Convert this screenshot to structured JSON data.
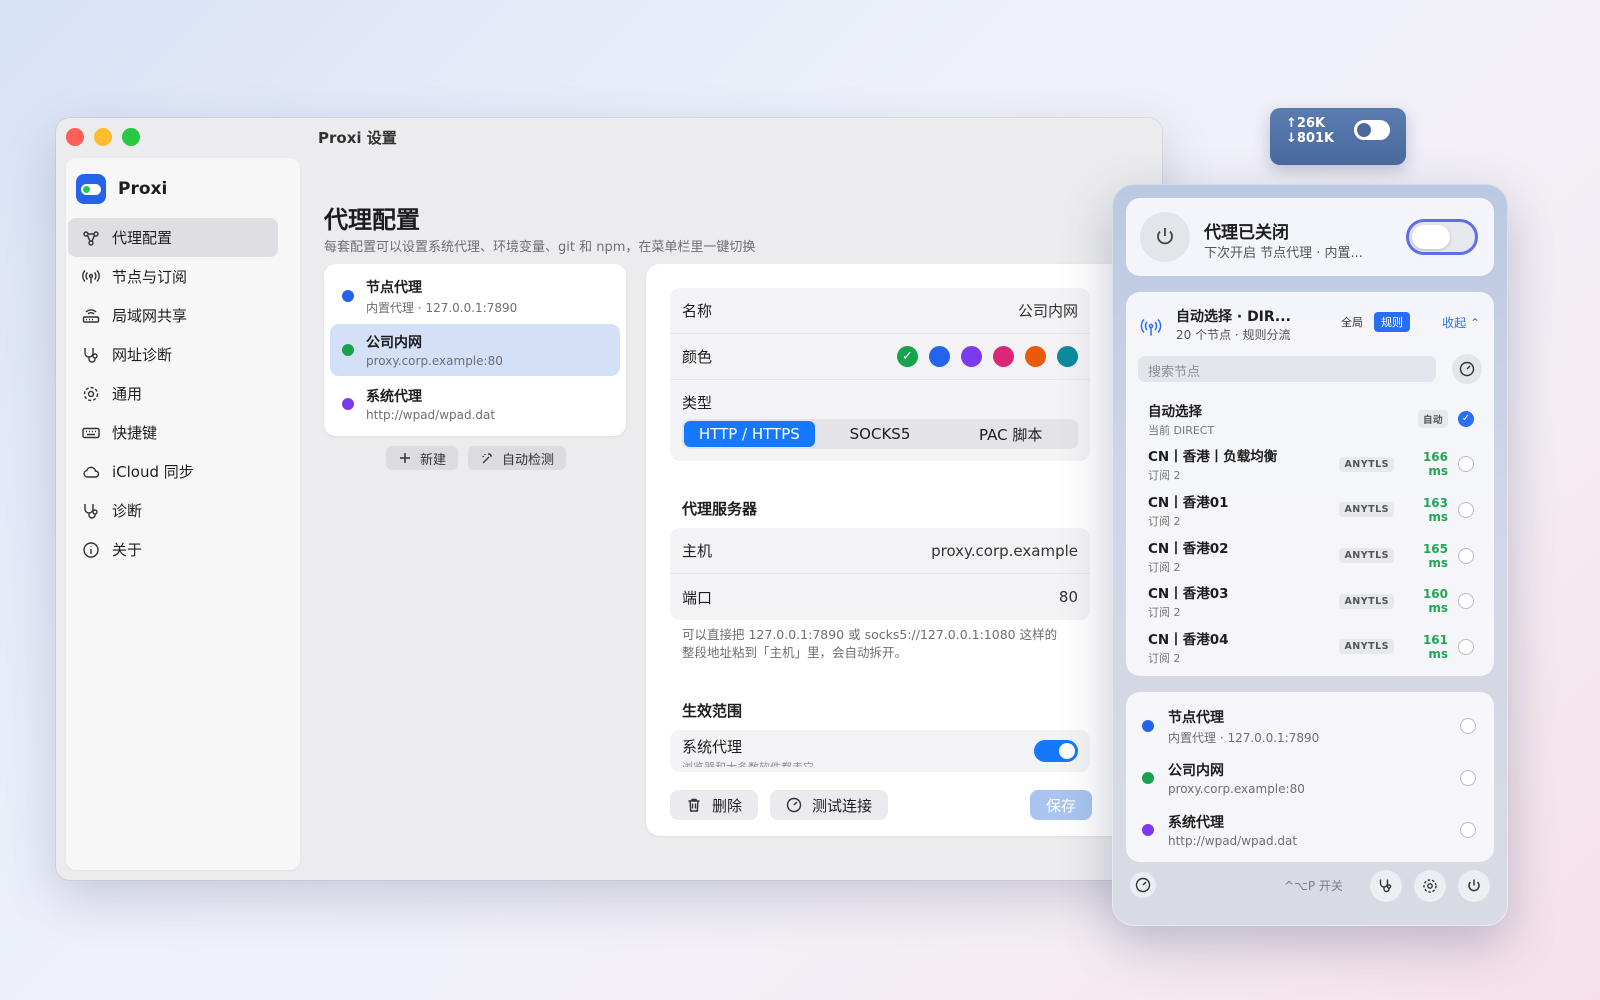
{
  "window": {
    "title": "Proxi 设置"
  },
  "sidebar": {
    "app_name": "Proxi",
    "items": [
      {
        "label": "代理配置",
        "icon": "share-nodes-icon",
        "active": true
      },
      {
        "label": "节点与订阅",
        "icon": "antenna-icon"
      },
      {
        "label": "局域网共享",
        "icon": "router-icon"
      },
      {
        "label": "网址诊断",
        "icon": "stethoscope-icon"
      },
      {
        "label": "通用",
        "icon": "gear-icon"
      },
      {
        "label": "快捷键",
        "icon": "keyboard-icon"
      },
      {
        "label": "iCloud 同步",
        "icon": "cloud-icon"
      },
      {
        "label": "诊断",
        "icon": "stethoscope-icon"
      },
      {
        "label": "关于",
        "icon": "info-icon"
      }
    ]
  },
  "main": {
    "title": "代理配置",
    "subtitle": "每套配置可以设置系统代理、环境变量、git 和 npm，在菜单栏里一键切换",
    "profiles": [
      {
        "name": "节点代理",
        "sub": "内置代理 · 127.0.0.1:7890",
        "color": "#2563eb",
        "selected": false
      },
      {
        "name": "公司内网",
        "sub": "proxy.corp.example:80",
        "color": "#16a34a",
        "selected": true
      },
      {
        "name": "系统代理",
        "sub": "http://wpad/wpad.dat",
        "color": "#7c3aed",
        "selected": false
      }
    ],
    "new_label": "新建",
    "auto_detect_label": "自动检测"
  },
  "detail": {
    "name_label": "名称",
    "name_value": "公司内网",
    "color_label": "颜色",
    "colors": [
      "#16a34a",
      "#2563eb",
      "#7c3aed",
      "#db2777",
      "#ea580c",
      "#0e8a9a"
    ],
    "selected_color_index": 0,
    "type_label": "类型",
    "types": [
      "HTTP / HTTPS",
      "SOCKS5",
      "PAC 脚本"
    ],
    "type_selected": 0,
    "server_heading": "代理服务器",
    "host_label": "主机",
    "host_value": "proxy.corp.example",
    "port_label": "端口",
    "port_value": "80",
    "hint_line1": "可以直接把 127.0.0.1:7890 或 socks5://127.0.0.1:1080 这样的",
    "hint_line2": "整段地址粘到「主机」里，会自动拆开。",
    "scope_heading": "生效范围",
    "scope_system_label": "系统代理",
    "scope_system_sub": "浏览器和大多数软件都走它",
    "scope_system_on": true,
    "delete_label": "删除",
    "test_label": "测试连接",
    "save_label": "保存"
  },
  "menubar": {
    "up_rate": "↑26K",
    "down_rate": "↓801K",
    "toggle_on": false
  },
  "popover": {
    "status_title": "代理已关闭",
    "status_sub": "下次开启 节点代理 · 内置...",
    "node_group_title": "自动选择 · DIR...",
    "node_group_sub": "20 个节点 · 规则分流",
    "modes": [
      "全局",
      "规则"
    ],
    "mode_selected": 1,
    "collapse_label": "收起",
    "search_placeholder": "搜索节点",
    "nodes": [
      {
        "name": "自动选择",
        "sub": "当前 DIRECT",
        "tag": "自动",
        "latency": "",
        "checked": true
      },
      {
        "name": "CN丨香港丨负载均衡",
        "sub": "订阅 2",
        "tag": "ANYTLS",
        "latency": "166 ms",
        "checked": false
      },
      {
        "name": "CN丨香港01",
        "sub": "订阅 2",
        "tag": "ANYTLS",
        "latency": "163 ms",
        "checked": false
      },
      {
        "name": "CN丨香港02",
        "sub": "订阅 2",
        "tag": "ANYTLS",
        "latency": "165 ms",
        "checked": false
      },
      {
        "name": "CN丨香港03",
        "sub": "订阅 2",
        "tag": "ANYTLS",
        "latency": "160 ms",
        "checked": false
      },
      {
        "name": "CN丨香港04",
        "sub": "订阅 2",
        "tag": "ANYTLS",
        "latency": "161 ms",
        "checked": false
      }
    ],
    "profiles": [
      {
        "name": "节点代理",
        "sub": "内置代理 · 127.0.0.1:7890",
        "color": "#2563eb"
      },
      {
        "name": "公司内网",
        "sub": "proxy.corp.example:80",
        "color": "#16a34a"
      },
      {
        "name": "系统代理",
        "sub": "http://wpad/wpad.dat",
        "color": "#7c3aed"
      }
    ],
    "shortcut_label": "^⌥P 开关"
  }
}
